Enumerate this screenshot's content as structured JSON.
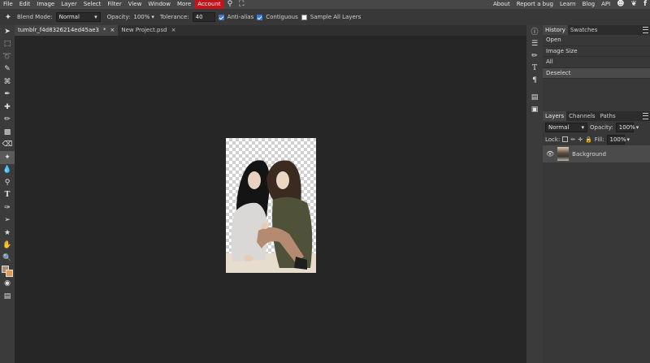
{
  "menu": {
    "items": [
      "File",
      "Edit",
      "Image",
      "Layer",
      "Select",
      "Filter",
      "View",
      "Window",
      "More"
    ],
    "account": "Account",
    "right_links": [
      "About",
      "Report a bug",
      "Learn",
      "Blog",
      "API"
    ]
  },
  "options": {
    "blend_label": "Blend Mode:",
    "blend_value": "Normal",
    "opacity_label": "Opacity:",
    "opacity_value": "100%",
    "tolerance_label": "Tolerance:",
    "tolerance_value": "40",
    "anti_alias": "Anti-alias",
    "contiguous": "Contiguous",
    "sample_all": "Sample All Layers"
  },
  "tabs": [
    {
      "label": "tumblr_f4d8326214ed45ae3",
      "mark": "*",
      "close": "×"
    },
    {
      "label": "New Project.psd",
      "close": "×"
    }
  ],
  "history": {
    "tabs": [
      "History",
      "Swatches"
    ],
    "rows": [
      "Open",
      "Image Size",
      "All",
      "Deselect"
    ]
  },
  "layers": {
    "tabs": [
      "Layers",
      "Channels",
      "Paths"
    ],
    "blend": "Normal",
    "opacity_label": "Opacity:",
    "opacity_value": "100%",
    "lock_label": "Lock:",
    "fill_label": "Fill:",
    "fill_value": "100%",
    "layer_name": "Background"
  },
  "colors": {
    "accent": "#c4131a",
    "foreground": "#b08a6e",
    "background_swatch": "#e09a5a"
  }
}
